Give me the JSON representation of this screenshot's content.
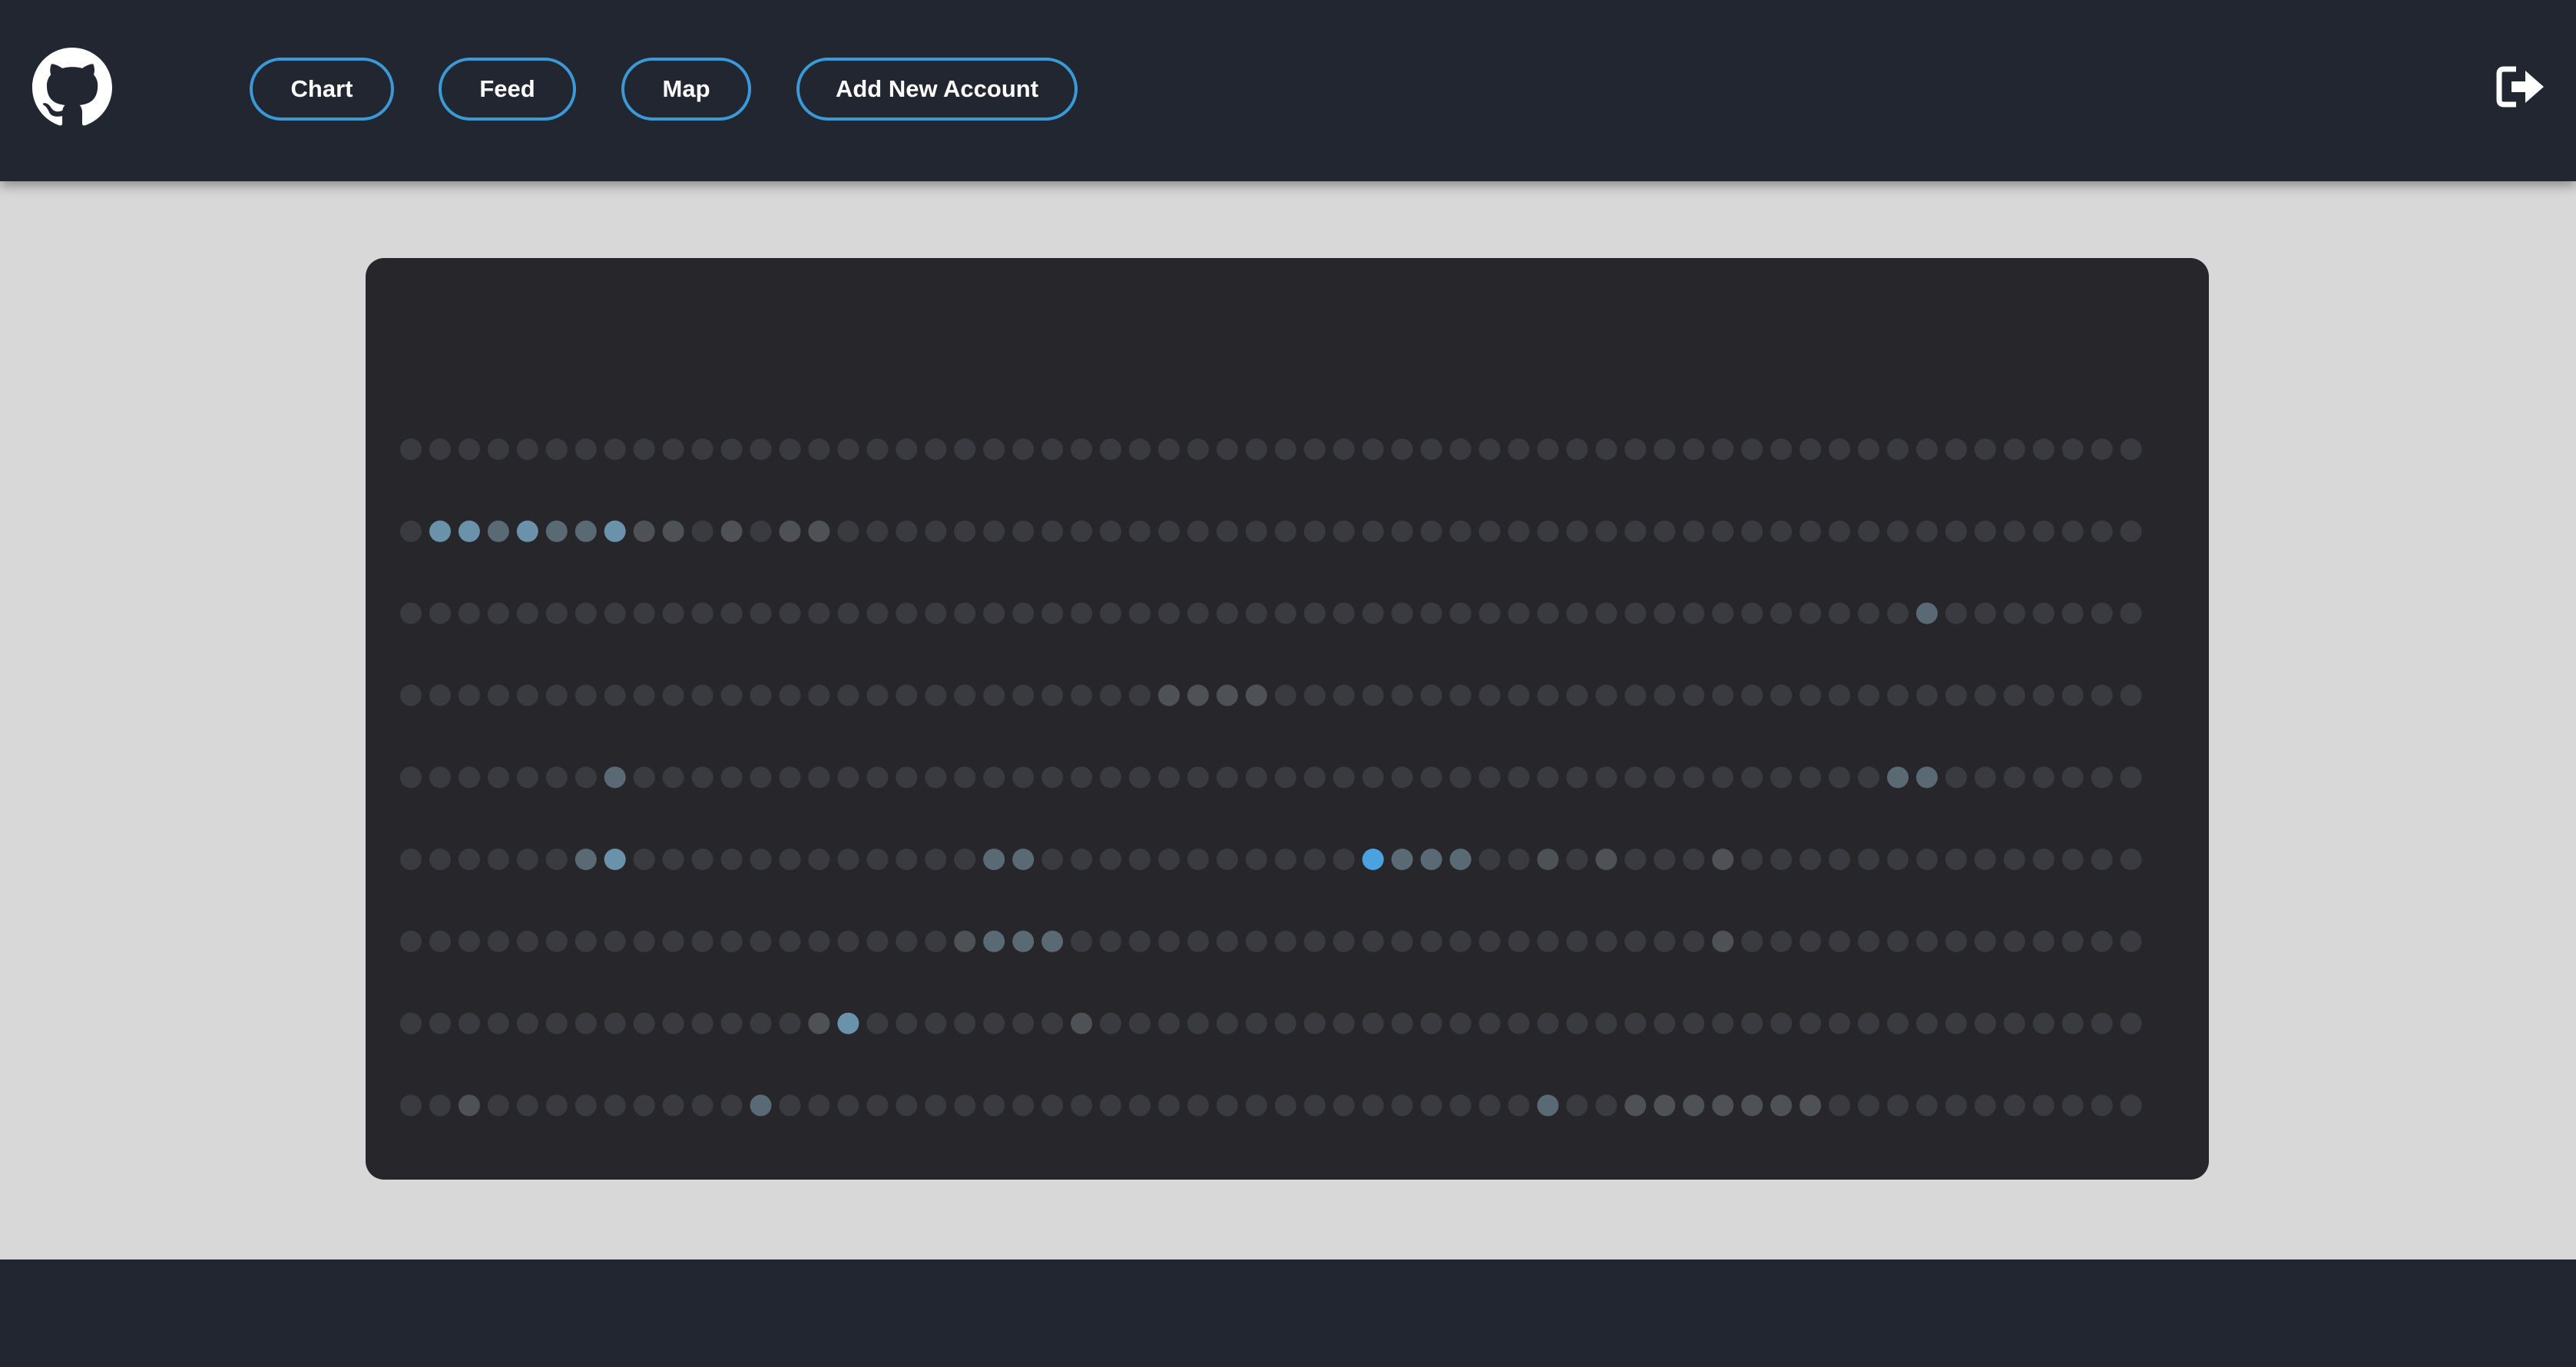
{
  "header": {
    "logo_icon": "github-icon",
    "nav": [
      {
        "id": "chart",
        "label": "Chart"
      },
      {
        "id": "feed",
        "label": "Feed"
      },
      {
        "id": "map",
        "label": "Map"
      },
      {
        "id": "add",
        "label": "Add New Account"
      }
    ],
    "logout_icon": "sign-out-icon"
  },
  "colors": {
    "header_bg": "#222630",
    "page_bg": "#d8d8d8",
    "card_bg": "#27272b",
    "accent": "#3a9ad8",
    "level_colors": [
      "#3a3b40",
      "#4e5257",
      "#5a6a75",
      "#6a93ab",
      "#4aa3de"
    ]
  },
  "chart_data": {
    "type": "heatmap",
    "rows": 9,
    "columns": 60,
    "levels": [
      "000000000000000000000000000000000000000000000000000000000000",
      "033232231101011000000000000000000000000000000000000000000000",
      "000000000000000000000000000000000000000000000000000020000000",
      "000000000000000000000000001111000000000000000000000000000000",
      "000000020000000000000000000000000000000000000000000220000000",
      "000000230000000000002200000000000422200101000100000000000000",
      "000000000000000000012220000000000000000000000100000000000000",
      "000000000000001300000001000000000000000000000000000000000000",
      "001000000000200000000000000000000000000200111111100000000000"
    ]
  }
}
